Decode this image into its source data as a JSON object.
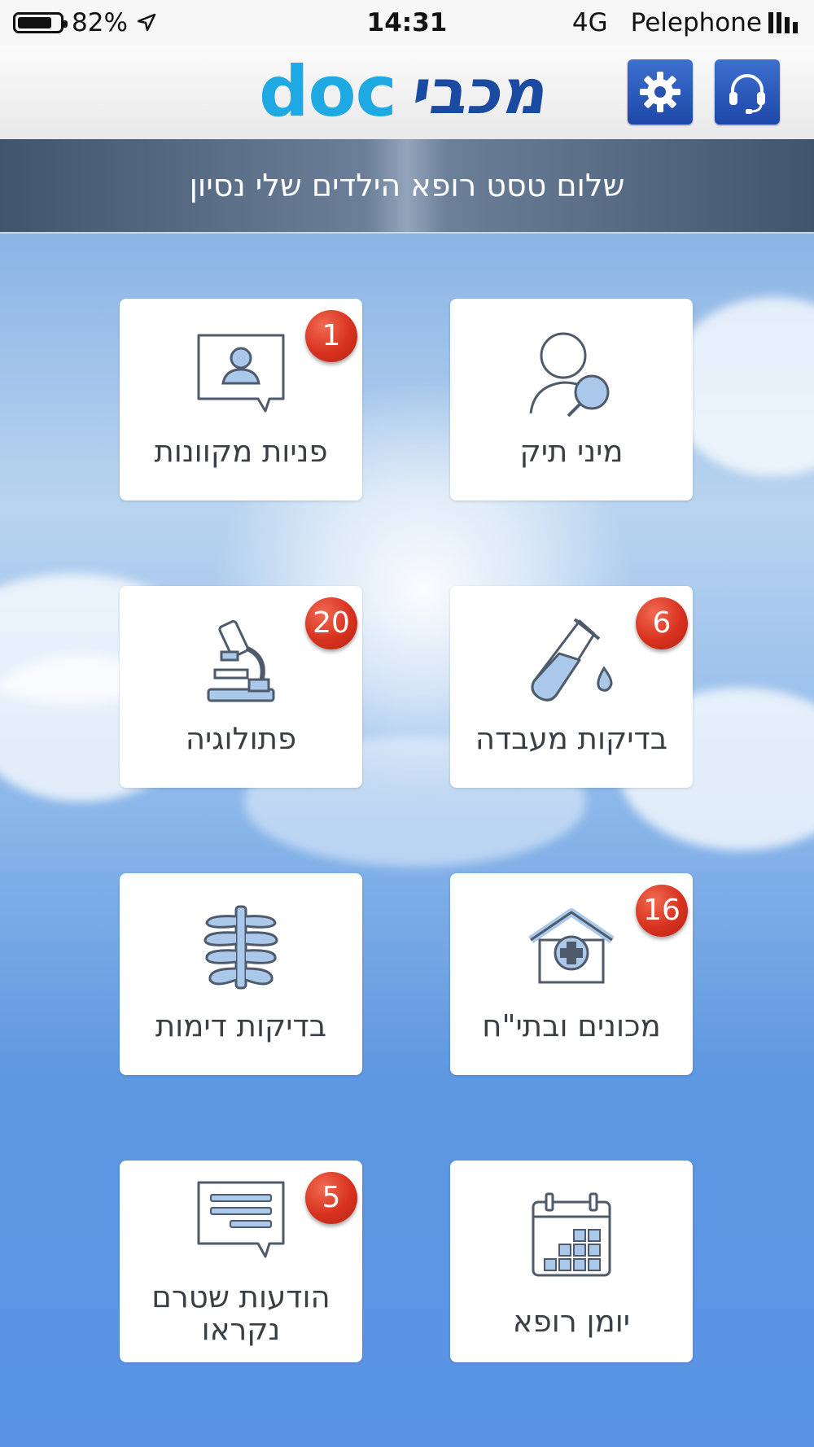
{
  "status_bar": {
    "battery_percent": "82%",
    "time": "14:31",
    "network": "4G",
    "carrier": "Pelephone",
    "battery_level": 0.82
  },
  "header": {
    "logo_text_latin": "doc",
    "logo_text_hebrew": "מכבי",
    "settings_icon": "gear-icon",
    "support_icon": "headset-icon",
    "accent_color": "#2852b0"
  },
  "greeting": {
    "text": "שלום טסט רופא הילדים שלי נסיון"
  },
  "tiles": [
    {
      "label": "מיני תיק",
      "icon": "patient-search-icon",
      "badge": ""
    },
    {
      "label": "פניות מקוונות",
      "icon": "online-inquiry-icon",
      "badge": "1"
    },
    {
      "label": "בדיקות מעבדה",
      "icon": "test-tube-icon",
      "badge": "6"
    },
    {
      "label": "פתולוגיה",
      "icon": "microscope-icon",
      "badge": "20"
    },
    {
      "label": "מכונים ובתי\"ח",
      "icon": "hospital-icon",
      "badge": "16"
    },
    {
      "label": "בדיקות דימות",
      "icon": "xray-ribcage-icon",
      "badge": ""
    },
    {
      "label": "יומן רופא",
      "icon": "calendar-icon",
      "badge": ""
    },
    {
      "label": "הודעות שטרם נקראו",
      "icon": "message-icon",
      "badge": "5"
    }
  ]
}
